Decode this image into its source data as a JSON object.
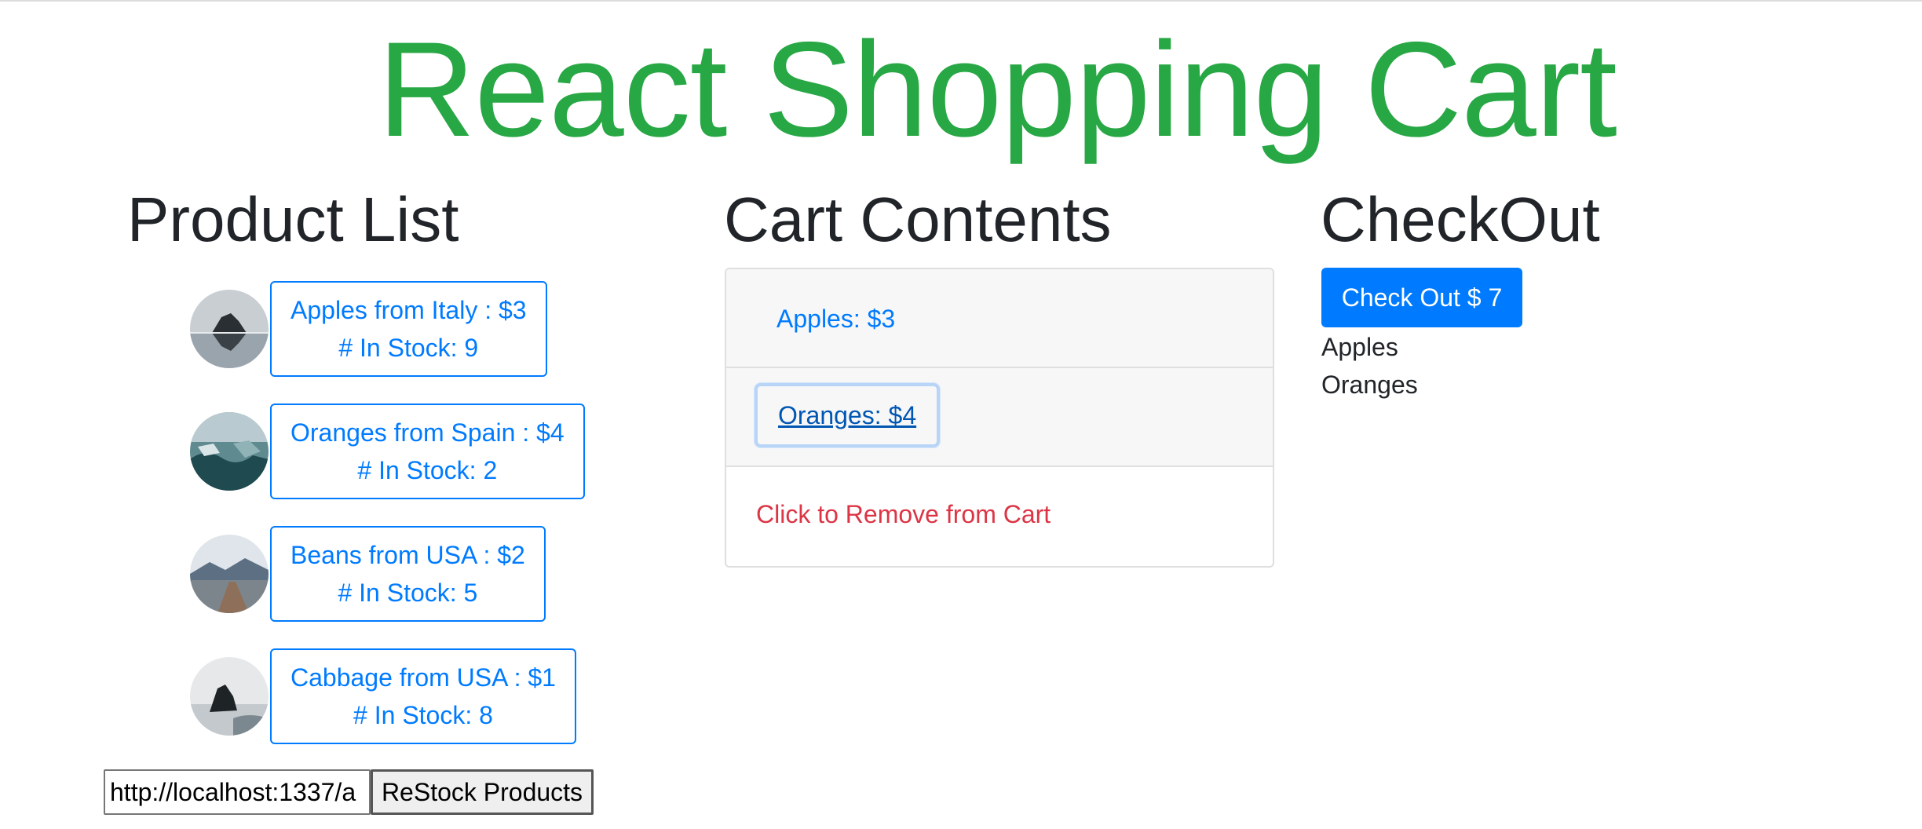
{
  "app": {
    "title": "React Shopping Cart"
  },
  "products": {
    "heading": "Product List",
    "items": [
      {
        "title": "Apples from Italy : $3",
        "stock": "# In Stock: 9",
        "image_icon": "mountain-lake-photo"
      },
      {
        "title": "Oranges from Spain : $4",
        "stock": "# In Stock: 2",
        "image_icon": "sea-rocks-photo"
      },
      {
        "title": "Beans from USA : $2",
        "stock": "# In Stock: 5",
        "image_icon": "mountain-road-photo"
      },
      {
        "title": "Cabbage from USA : $1",
        "stock": "# In Stock: 8",
        "image_icon": "rock-coast-photo"
      }
    ],
    "restock": {
      "url_value": "http://localhost:1337/a",
      "button_label": "ReStock Products"
    }
  },
  "cart": {
    "heading": "Cart Contents",
    "items": [
      {
        "label": "Apples: $3"
      },
      {
        "label": "Oranges: $4"
      }
    ],
    "hint": "Click to Remove from Cart"
  },
  "checkout": {
    "heading": "CheckOut",
    "button_label": "Check Out $ 7",
    "items": [
      "Apples",
      "Oranges"
    ]
  },
  "colors": {
    "title_green": "#28a745",
    "primary_blue": "#007bff",
    "danger_red": "#dc3545"
  }
}
